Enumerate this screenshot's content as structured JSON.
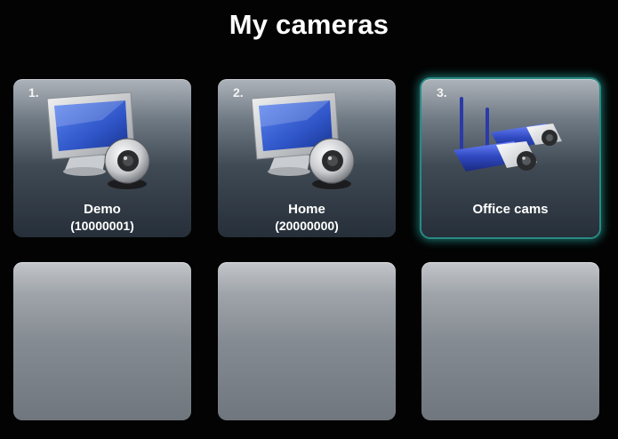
{
  "header": {
    "title": "My cameras"
  },
  "tiles": [
    {
      "number": "1.",
      "label": "Demo",
      "sublabel": "(10000001)",
      "icon": "monitor-webcam-icon"
    },
    {
      "number": "2.",
      "label": "Home",
      "sublabel": "(20000000)",
      "icon": "monitor-webcam-icon"
    },
    {
      "number": "3.",
      "label": "Office cams",
      "sublabel": "",
      "icon": "ip-cameras-icon",
      "selected": true
    },
    {
      "empty": true
    },
    {
      "empty": true
    },
    {
      "empty": true
    }
  ],
  "colors": {
    "background": "#030303",
    "selection_glow": "#28beb4",
    "monitor_screen": "#2f55c8",
    "ip_camera_body": "#2f49c0"
  }
}
